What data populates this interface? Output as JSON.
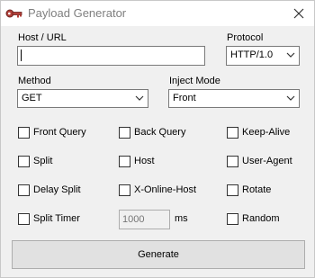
{
  "window": {
    "title": "Payload Generator",
    "icon": "key-icon",
    "close": "close-icon"
  },
  "host": {
    "label": "Host / URL",
    "value": ""
  },
  "protocol": {
    "label": "Protocol",
    "value": "HTTP/1.0"
  },
  "method": {
    "label": "Method",
    "value": "GET"
  },
  "inject_mode": {
    "label": "Inject Mode",
    "value": "Front"
  },
  "options": {
    "front_query": "Front Query",
    "back_query": "Back Query",
    "keep_alive": "Keep-Alive",
    "split": "Split",
    "host": "Host",
    "user_agent": "User-Agent",
    "delay_split": "Delay Split",
    "x_online_host": "X-Online-Host",
    "rotate": "Rotate",
    "split_timer": "Split Timer",
    "random": "Random"
  },
  "split_timer": {
    "placeholder": "1000",
    "unit": "ms"
  },
  "generate_button": "Generate"
}
